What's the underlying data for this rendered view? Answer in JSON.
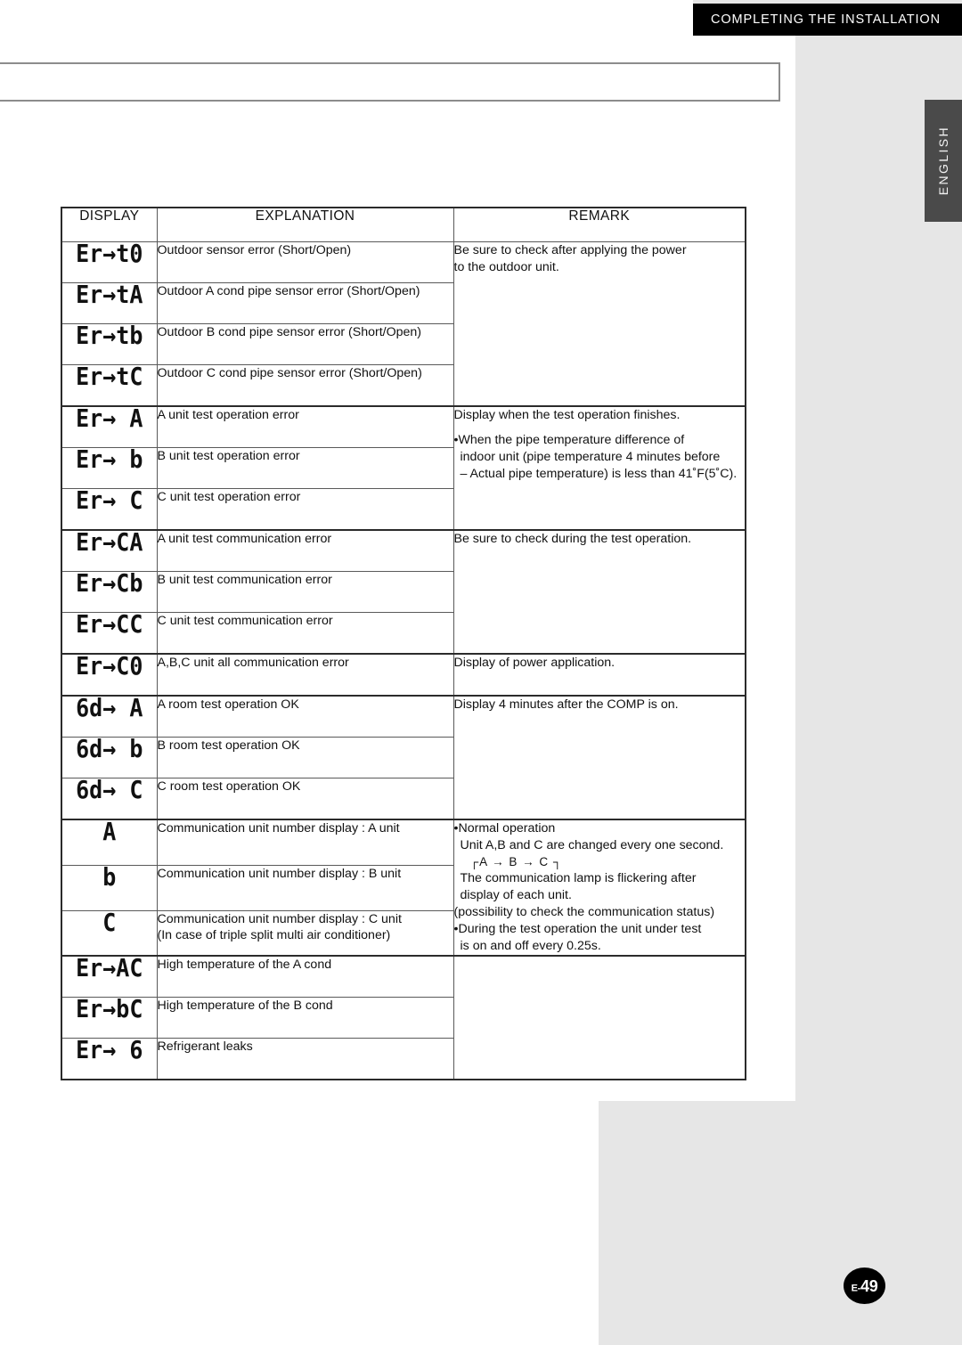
{
  "banner": {
    "title": "COMPLETING THE INSTALLATION"
  },
  "lang_tab": {
    "label": "ENGLISH"
  },
  "page_number": {
    "prefix": "E-",
    "value": "49",
    "full": "E-49"
  },
  "table": {
    "headers": {
      "display": "DISPLAY",
      "explanation": "EXPLANATION",
      "remark": "REMARK"
    },
    "rows": [
      {
        "display": "Er→t0",
        "explanation": "Outdoor sensor error (Short/Open)"
      },
      {
        "display": "Er→tA",
        "explanation": "Outdoor A cond pipe sensor error (Short/Open)"
      },
      {
        "display": "Er→tb",
        "explanation": "Outdoor B cond pipe sensor error (Short/Open)"
      },
      {
        "display": "Er→tC",
        "explanation": "Outdoor C cond pipe sensor error (Short/Open)"
      },
      {
        "display": "Er→ A",
        "explanation": "A unit test operation error"
      },
      {
        "display": "Er→ b",
        "explanation": "B unit test operation error"
      },
      {
        "display": "Er→ C",
        "explanation": "C unit test operation error"
      },
      {
        "display": "Er→CA",
        "explanation": "A unit test communication error"
      },
      {
        "display": "Er→Cb",
        "explanation": "B unit test communication error"
      },
      {
        "display": "Er→CC",
        "explanation": "C unit test communication error"
      },
      {
        "display": "Er→C0",
        "explanation": "A,B,C unit all communication error"
      },
      {
        "display": "6d→ A",
        "explanation": "A room test operation OK"
      },
      {
        "display": "6d→ b",
        "explanation": "B room test operation OK"
      },
      {
        "display": "6d→ C",
        "explanation": "C room test operation OK"
      },
      {
        "display": "A",
        "explanation": "Communication unit number display : A unit"
      },
      {
        "display": "b",
        "explanation": "Communication unit number display : B unit"
      },
      {
        "display": "C",
        "explanation": "Communication unit number display : C unit",
        "explanation2": "(In case of triple split multi air conditioner)"
      },
      {
        "display": "Er→AC",
        "explanation": "High temperature of the A cond"
      },
      {
        "display": "Er→bC",
        "explanation": "High temperature of the B cond"
      },
      {
        "display": "Er→ 6",
        "explanation": "Refrigerant leaks"
      }
    ],
    "remarks": {
      "r1_line1": "Be sure to check after applying the power",
      "r1_line2": "to the outdoor unit.",
      "r2_line1": "Display when the test operation finishes.",
      "r2_line2": "•When the pipe temperature difference of",
      "r2_line3": "indoor unit (pipe temperature 4 minutes before",
      "r2_line4": "– Actual pipe temperature) is less than 41˚F(5˚C).",
      "r3_line1": "Be sure to check during the test operation.",
      "r4_line1": "Display of power application.",
      "r5_line1": "Display 4 minutes after the COMP is on.",
      "r6_line1": "•Normal operation",
      "r6_line2": "Unit A,B and C are changed every one second.",
      "r6_diagram": "┌A → B → C ┐",
      "r6_line3": "The communication lamp is flickering after",
      "r6_line4": "display of each unit.",
      "r6_line5": "(possibility to check the communication status)",
      "r6_line6": "•During the test operation the unit under test",
      "r6_line7": "is on and off every 0.25s."
    }
  }
}
